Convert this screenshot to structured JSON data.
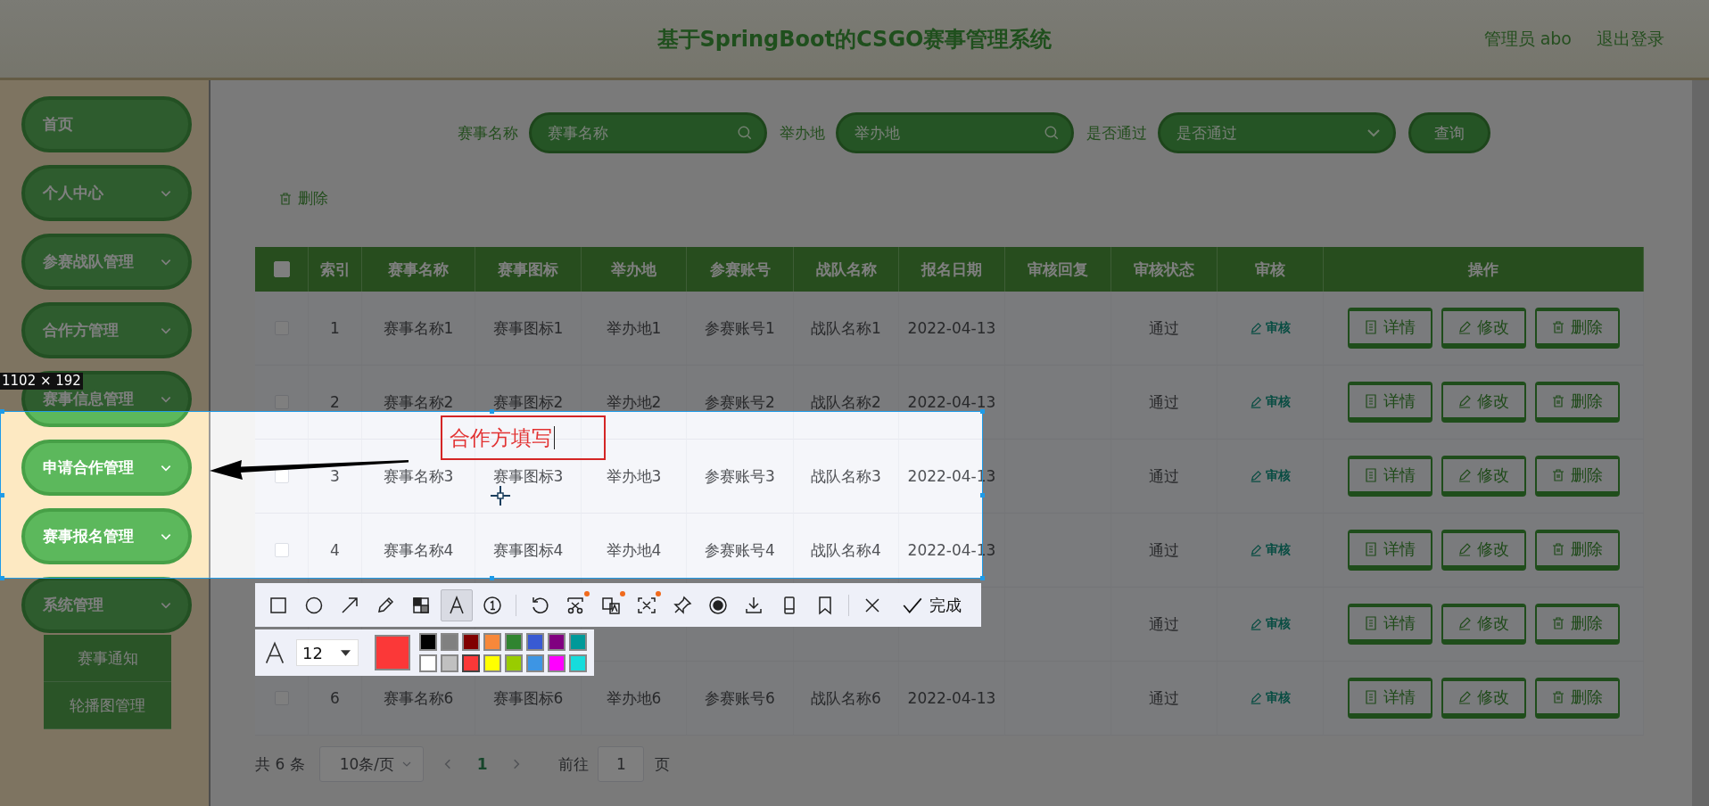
{
  "header": {
    "title": "基于SpringBoot的CSGO赛事管理系统",
    "user": "管理员 abo",
    "logout": "退出登录"
  },
  "sidebar": {
    "items": [
      {
        "label": "首页",
        "expandable": false
      },
      {
        "label": "个人中心",
        "expandable": true
      },
      {
        "label": "参赛战队管理",
        "expandable": true
      },
      {
        "label": "合作方管理",
        "expandable": true
      },
      {
        "label": "赛事信息管理",
        "expandable": true
      },
      {
        "label": "申请合作管理",
        "expandable": true
      },
      {
        "label": "赛事报名管理",
        "expandable": true
      },
      {
        "label": "系统管理",
        "expandable": true,
        "children": [
          {
            "label": "赛事通知"
          },
          {
            "label": "轮播图管理"
          }
        ]
      }
    ]
  },
  "search": {
    "fields": [
      {
        "label": "赛事名称",
        "placeholder": "赛事名称",
        "kind": "text"
      },
      {
        "label": "举办地",
        "placeholder": "举办地",
        "kind": "text"
      },
      {
        "label": "是否通过",
        "placeholder": "是否通过",
        "kind": "select"
      }
    ],
    "button": "查询"
  },
  "actions": {
    "delete": "删除"
  },
  "table": {
    "all_checked": false,
    "columns": [
      "索引",
      "赛事名称",
      "赛事图标",
      "举办地",
      "参赛账号",
      "战队名称",
      "报名日期",
      "审核回复",
      "审核状态",
      "审核",
      "操作"
    ],
    "rows": [
      {
        "checked": false,
        "index": "1",
        "name": "赛事名称1",
        "icon": "赛事图标1",
        "place": "举办地1",
        "account": "参赛账号1",
        "team": "战队名称1",
        "date": "2022-04-13",
        "status": "通过",
        "review": "审核",
        "actions": [
          "详情",
          "修改",
          "删除"
        ]
      },
      {
        "checked": false,
        "index": "2",
        "name": "赛事名称2",
        "icon": "赛事图标2",
        "place": "举办地2",
        "account": "参赛账号2",
        "team": "战队名称2",
        "date": "2022-04-13",
        "status": "通过",
        "review": "审核",
        "actions": [
          "详情",
          "修改",
          "删除"
        ]
      },
      {
        "checked": false,
        "index": "3",
        "name": "赛事名称3",
        "icon": "赛事图标3",
        "place": "举办地3",
        "account": "参赛账号3",
        "team": "战队名称3",
        "date": "2022-04-13",
        "status": "通过",
        "review": "审核",
        "actions": [
          "详情",
          "修改",
          "删除"
        ]
      },
      {
        "checked": false,
        "index": "4",
        "name": "赛事名称4",
        "icon": "赛事图标4",
        "place": "举办地4",
        "account": "参赛账号4",
        "team": "战队名称4",
        "date": "2022-04-13",
        "status": "通过",
        "review": "审核",
        "actions": [
          "详情",
          "修改",
          "删除"
        ]
      },
      {
        "status": "通过",
        "review": "审核",
        "actions": [
          "详情",
          "修改",
          "删除"
        ]
      },
      {
        "checked": false,
        "index": "6",
        "name": "赛事名称6",
        "icon": "赛事图标6",
        "place": "举办地6",
        "account": "参赛账号6",
        "team": "战队名称6",
        "date": "2022-04-13",
        "status": "通过",
        "review": "审核",
        "actions": [
          "详情",
          "修改",
          "删除"
        ]
      }
    ]
  },
  "pagination": {
    "total": "共 6 条",
    "page_size": "10条/页",
    "pages": [
      {
        "label": "1",
        "selected": true
      }
    ],
    "goto_label": "前往",
    "goto_value": "1",
    "goto_suffix": "页"
  },
  "screenshot_tool": {
    "size_label": "1102 × 192",
    "annotation_text": "合作方填写",
    "done": "完成",
    "font_size": "12",
    "tools": [
      {
        "kind": "rect",
        "selected": false,
        "badge": false
      },
      {
        "kind": "ellipse",
        "selected": false,
        "badge": false
      },
      {
        "kind": "arrow",
        "selected": false,
        "badge": false
      },
      {
        "kind": "pencil",
        "selected": false,
        "badge": false
      },
      {
        "kind": "mosaic",
        "selected": false,
        "badge": false
      },
      {
        "kind": "text",
        "selected": true,
        "badge": false
      },
      {
        "kind": "number",
        "selected": false,
        "badge": false
      },
      {
        "kind": "separator"
      },
      {
        "kind": "undo",
        "selected": false,
        "badge": false
      },
      {
        "kind": "cut",
        "selected": false,
        "badge": true
      },
      {
        "kind": "translate",
        "selected": false,
        "badge": true
      },
      {
        "kind": "scan",
        "selected": false,
        "badge": true
      },
      {
        "kind": "pin",
        "selected": false,
        "badge": false
      },
      {
        "kind": "record",
        "selected": false,
        "badge": false
      },
      {
        "kind": "download",
        "selected": false,
        "badge": false
      },
      {
        "kind": "device",
        "selected": false,
        "badge": false
      },
      {
        "kind": "bookmark",
        "selected": false,
        "badge": false
      },
      {
        "kind": "separator"
      },
      {
        "kind": "close",
        "selected": false,
        "badge": false
      }
    ],
    "palette": [
      {
        "color": "#000000",
        "selected": false
      },
      {
        "color": "#808080",
        "selected": false
      },
      {
        "color": "#800000",
        "selected": false
      },
      {
        "color": "#f7883a",
        "selected": false
      },
      {
        "color": "#308430",
        "selected": false
      },
      {
        "color": "#385ad3",
        "selected": false
      },
      {
        "color": "#800080",
        "selected": false
      },
      {
        "color": "#009999",
        "selected": false
      },
      {
        "color": "#ffffff",
        "selected": false
      },
      {
        "color": "#c0c0c0",
        "selected": false
      },
      {
        "color": "#fb3838",
        "selected": true
      },
      {
        "color": "#ffff00",
        "selected": false
      },
      {
        "color": "#99cc00",
        "selected": false
      },
      {
        "color": "#3d95e4",
        "selected": false
      },
      {
        "color": "#ff00ff",
        "selected": false
      },
      {
        "color": "#16dcdc",
        "selected": false
      }
    ]
  }
}
